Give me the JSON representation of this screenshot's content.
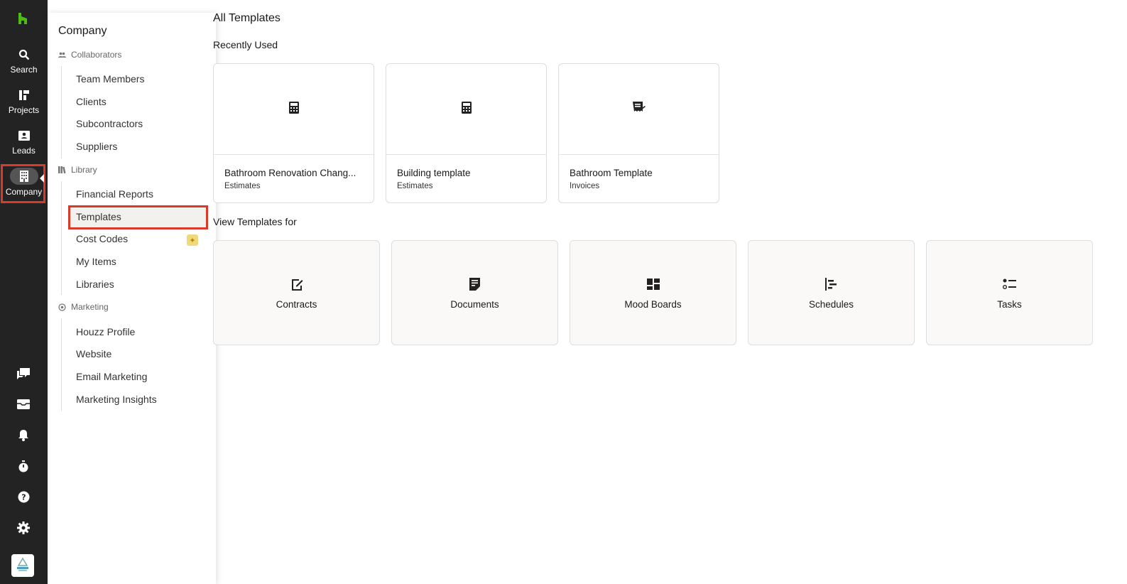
{
  "rail": {
    "items": [
      {
        "label": "Search",
        "icon": "search-icon"
      },
      {
        "label": "Projects",
        "icon": "projects-icon"
      },
      {
        "label": "Leads",
        "icon": "leads-icon"
      },
      {
        "label": "Company",
        "icon": "building-icon"
      }
    ],
    "bottom_icons": [
      "chat-icon",
      "inbox-icon",
      "bell-icon",
      "timer-icon",
      "help-icon",
      "gear-icon"
    ],
    "brand_color": "#4dbc15",
    "active_item": "Company"
  },
  "panel": {
    "title": "Company",
    "sections": [
      {
        "heading": "Collaborators",
        "icon": "people-icon",
        "items": [
          "Team Members",
          "Clients",
          "Subcontractors",
          "Suppliers"
        ]
      },
      {
        "heading": "Library",
        "icon": "library-icon",
        "items": [
          "Financial Reports",
          "Templates",
          "Cost Codes",
          "My Items",
          "Libraries"
        ]
      },
      {
        "heading": "Marketing",
        "icon": "at-icon",
        "items": [
          "Houzz Profile",
          "Website",
          "Email Marketing",
          "Marketing Insights"
        ]
      }
    ],
    "selected_item": "Templates",
    "highlight_color": "#d93a2a"
  },
  "main": {
    "title": "All Templates",
    "recent_heading": "Recently Used",
    "recent": [
      {
        "name": "Bathroom Renovation Chang...",
        "kind": "Estimates",
        "icon": "calculator-icon"
      },
      {
        "name": "Building template",
        "kind": "Estimates",
        "icon": "calculator-icon"
      },
      {
        "name": "Bathroom Template",
        "kind": "Invoices",
        "icon": "invoice-icon"
      }
    ],
    "types_heading": "View Templates for",
    "types": [
      {
        "label": "Contracts",
        "icon": "contract-icon"
      },
      {
        "label": "Documents",
        "icon": "document-icon"
      },
      {
        "label": "Mood Boards",
        "icon": "moodboard-icon"
      },
      {
        "label": "Schedules",
        "icon": "schedule-icon"
      },
      {
        "label": "Tasks",
        "icon": "tasks-icon"
      }
    ]
  }
}
